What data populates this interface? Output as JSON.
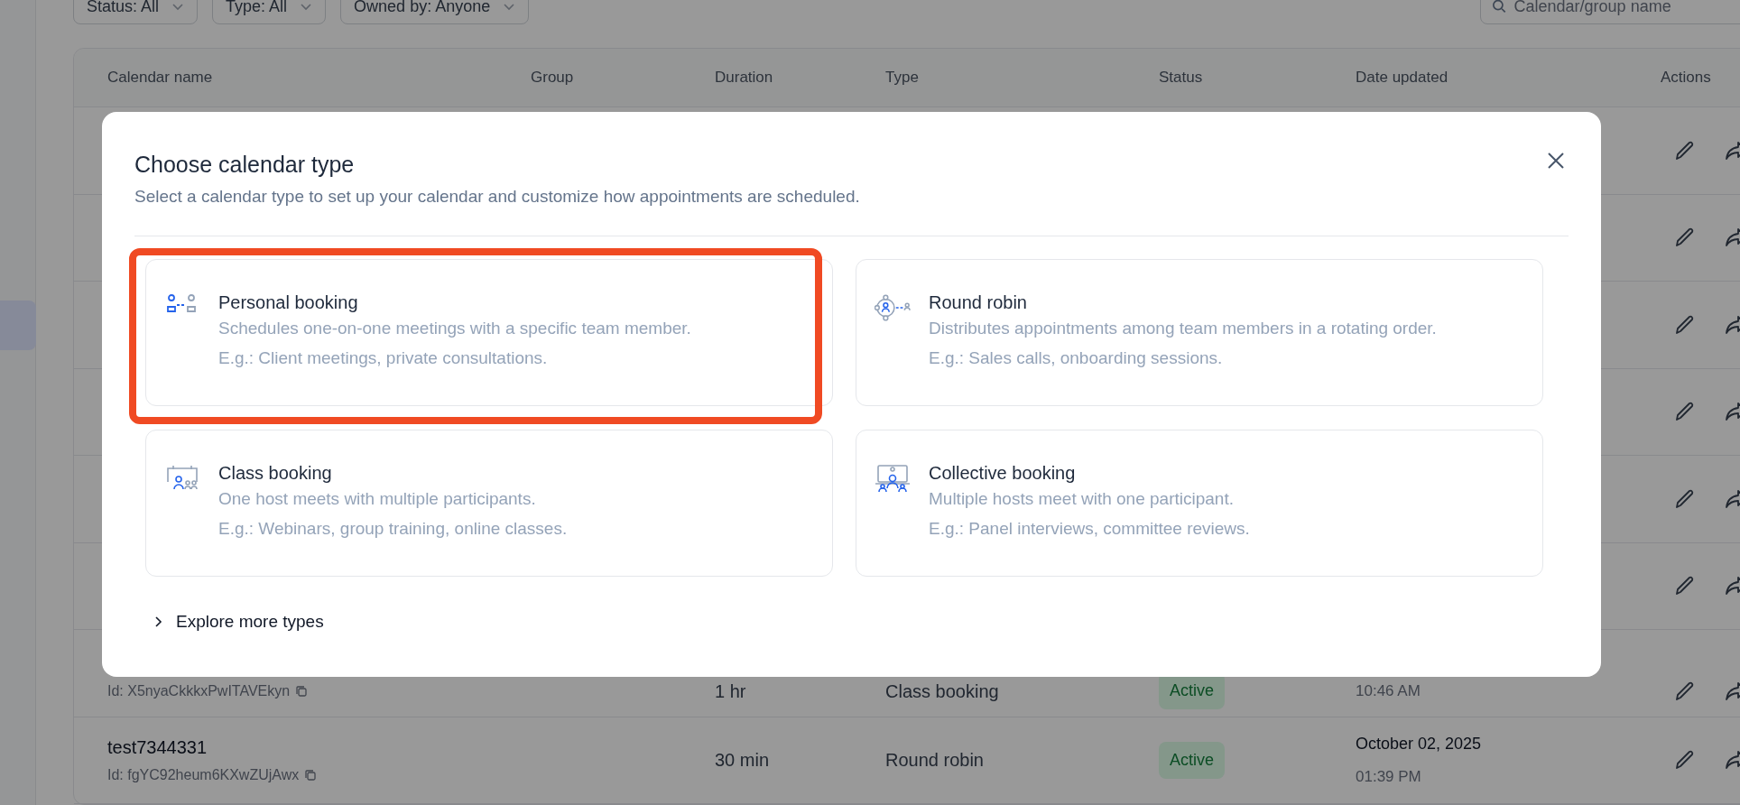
{
  "filters": [
    {
      "label": "Status: All"
    },
    {
      "label": "Type: All"
    },
    {
      "label": "Owned by: Anyone"
    }
  ],
  "search": {
    "placeholder": "Calendar/group name"
  },
  "table": {
    "columns": [
      "Calendar name",
      "Group",
      "Duration",
      "Type",
      "Status",
      "Date updated",
      "Actions"
    ],
    "rows": [
      {
        "kind": "covered"
      },
      {
        "kind": "covered"
      },
      {
        "kind": "covered"
      },
      {
        "kind": "covered"
      },
      {
        "kind": "covered"
      },
      {
        "kind": "covered"
      },
      {
        "kind": "partial",
        "id": "Id: X5nyaCkkkxPwITAVEkyn",
        "duration": "1 hr",
        "type": "Class booking",
        "status": "Active",
        "time": "10:46 AM"
      },
      {
        "kind": "full",
        "name": "test7344331",
        "id": "Id: fgYC92heum6KXwZUjAwx",
        "duration": "30 min",
        "type": "Round robin",
        "status": "Active",
        "date": "October 02, 2025",
        "time": "01:39 PM"
      }
    ]
  },
  "modal": {
    "title": "Choose calendar type",
    "subtitle": "Select a calendar type to set up your calendar and customize how appointments are scheduled.",
    "types": [
      {
        "kind": "personal",
        "title": "Personal booking",
        "description": "Schedules one-on-one meetings with a specific team member.",
        "example": "E.g.: Client meetings, private consultations.",
        "highlighted": true
      },
      {
        "kind": "round_robin",
        "title": "Round robin",
        "description": "Distributes appointments among team members in a rotating order.",
        "example": "E.g.: Sales calls, onboarding sessions.",
        "highlighted": false
      },
      {
        "kind": "class",
        "title": "Class booking",
        "description": "One host meets with multiple participants.",
        "example": "E.g.: Webinars, group training, online classes.",
        "highlighted": false
      },
      {
        "kind": "collective",
        "title": "Collective booking",
        "description": "Multiple hosts meet with one participant.",
        "example": "E.g.: Panel interviews, committee reviews.",
        "highlighted": false
      }
    ],
    "explore": {
      "label": "Explore more types",
      "expanded": false
    }
  }
}
